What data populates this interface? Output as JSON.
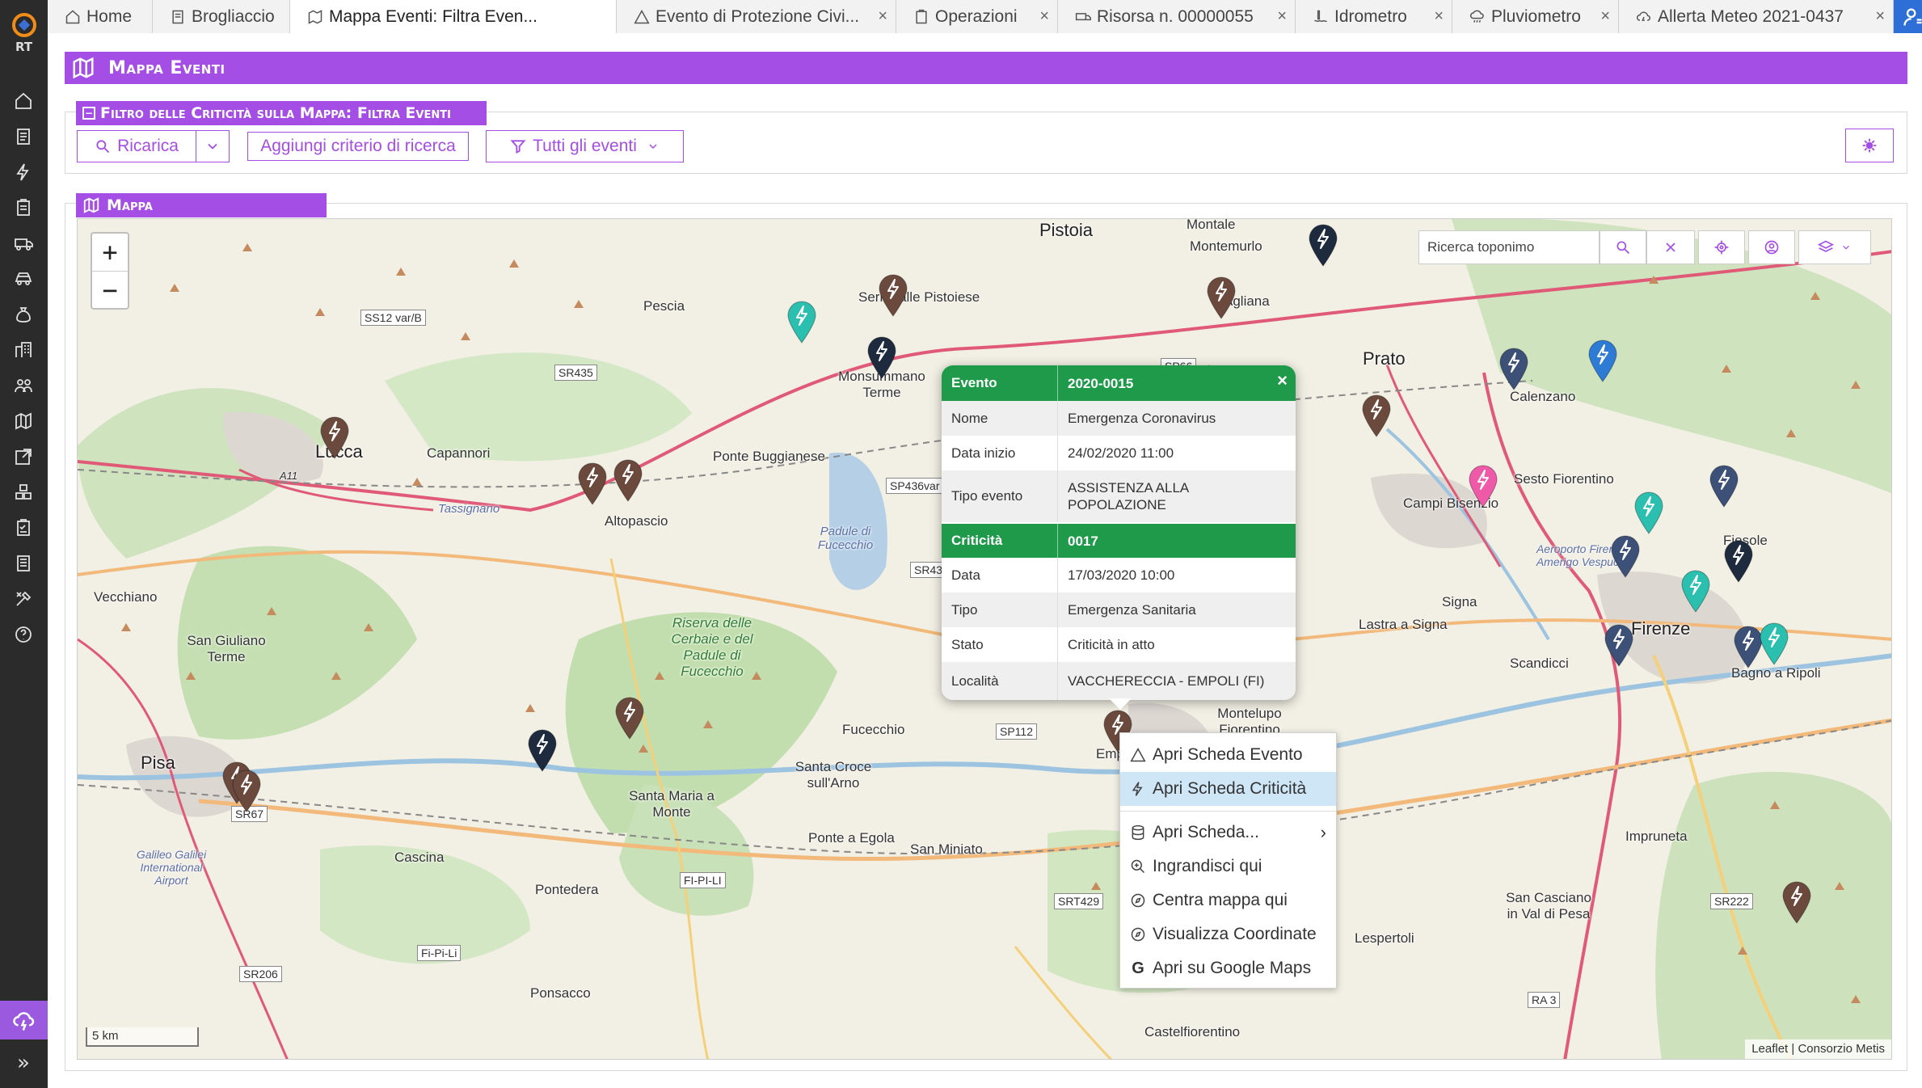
{
  "app": {
    "logo_text": "RT"
  },
  "tabs": [
    {
      "label": "Home",
      "icon": "home-icon",
      "closable": false
    },
    {
      "label": "Brogliaccio",
      "icon": "document-icon",
      "closable": false
    },
    {
      "label": "Mappa Eventi: Filtra Even...",
      "icon": "map-icon",
      "closable": false,
      "active": true
    },
    {
      "label": "Evento di Protezione Civi...",
      "icon": "triangle-icon",
      "closable": true
    },
    {
      "label": "Operazioni",
      "icon": "clipboard-icon",
      "closable": true
    },
    {
      "label": "Risorsa n. 00000055",
      "icon": "truck-icon",
      "closable": true
    },
    {
      "label": "Idrometro",
      "icon": "water-gauge-icon",
      "closable": true
    },
    {
      "label": "Pluviometro",
      "icon": "rain-icon",
      "closable": true
    },
    {
      "label": "Allerta Meteo 2021-0437",
      "icon": "alert-cloud-icon",
      "closable": true
    }
  ],
  "tab_close_glyph": "×",
  "page": {
    "title": "Mappa Eventi"
  },
  "filter": {
    "title": "Filtro delle Criticità sulla Mappa: Filtra Eventi",
    "collapse_glyph": "−",
    "reload_label": "Ricarica",
    "add_criterion_label": "Aggiungi criterio di ricerca",
    "events_dropdown_label": "Tutti gli eventi"
  },
  "map_panel": {
    "title": "Mappa"
  },
  "map": {
    "zoom_in": "+",
    "zoom_out": "−",
    "search_placeholder": "Ricerca toponimo",
    "scale_label": "5 km",
    "attribution": "Leaflet | Consorzio Metis",
    "places": [
      "Pistoia",
      "Montale",
      "Montemurlo",
      "Prato",
      "Pescia",
      "Serravalle Pistoiese",
      "Agliana",
      "Monsummano Terme",
      "Calenzano",
      "Lucca",
      "Capannori",
      "Tassignano",
      "Altopascio",
      "Ponte Buggianese",
      "Padule di Fucecchio",
      "Sesto Fiorentino",
      "Campi Bisenzio",
      "Fiesole",
      "Aeroporto Firenze Amerigo Vespucci",
      "Signa",
      "Lastra a Signa",
      "Firenze",
      "Scandicci",
      "Bagno a Ripoli",
      "Vecchiano",
      "San Giuliano Terme",
      "Riserva delle Cerbaie e del Padule di Fucecchio",
      "Montelupo Fiorentino",
      "Fucecchio",
      "Pisa",
      "Santa Croce sull'Arno",
      "Santa Maria a Monte",
      "Galileo Galilei International Airport",
      "Cascina",
      "Pontedera",
      "Ponte a Egola",
      "San Miniato",
      "Impruneta",
      "San Casciano in Val di Pesa",
      "Lespertoli",
      "Ponsacco",
      "Castelfiorentino",
      "Empoli"
    ],
    "roads": [
      "SS12 var/B",
      "SR435",
      "SP436var",
      "SR43",
      "SP112",
      "SR67",
      "FI-PI-LI",
      "Fi-Pi-Li",
      "SR206",
      "SRT429",
      "SR222",
      "RA 3",
      "A11",
      "SP66"
    ]
  },
  "popup": {
    "close_glyph": "×",
    "event_header": {
      "key": "Evento",
      "value": "2020-0015"
    },
    "event_rows": [
      {
        "key": "Nome",
        "value": "Emergenza Coronavirus"
      },
      {
        "key": "Data inizio",
        "value": "24/02/2020 11:00"
      },
      {
        "key": "Tipo evento",
        "value": "ASSISTENZA ALLA POPOLAZIONE"
      }
    ],
    "criticity_header": {
      "key": "Criticità",
      "value": "0017"
    },
    "criticity_rows": [
      {
        "key": "Data",
        "value": "17/03/2020 10:00"
      },
      {
        "key": "Tipo",
        "value": "Emergenza Sanitaria"
      },
      {
        "key": "Stato",
        "value": "Criticità in atto"
      },
      {
        "key": "Località",
        "value": "VACCHERECCIA - EMPOLI (FI)"
      }
    ]
  },
  "context_menu": {
    "items": [
      {
        "label": "Apri Scheda Evento",
        "icon": "triangle-icon"
      },
      {
        "label": "Apri Scheda Criticità",
        "icon": "bolt-icon",
        "selected": true
      },
      {
        "label": "Apri Scheda...",
        "icon": "database-icon",
        "submenu": true
      },
      {
        "label": "Ingrandisci qui",
        "icon": "zoom-in-icon"
      },
      {
        "label": "Centra mappa qui",
        "icon": "compass-icon"
      },
      {
        "label": "Visualizza Coordinate",
        "icon": "compass-icon"
      },
      {
        "label": "Apri su Google Maps",
        "icon": "google-icon"
      }
    ],
    "submenu_glyph": "›",
    "google_glyph": "G"
  },
  "colors": {
    "accent": "#a54ee6",
    "header_green": "#1e9a4a",
    "marker_brown": "#6b4a3d",
    "marker_navy": "#1e2a3e",
    "marker_slate": "#3c5078",
    "marker_teal": "#2bbfb0",
    "marker_blue": "#2e7bd6",
    "marker_pink": "#ee5aa8"
  }
}
